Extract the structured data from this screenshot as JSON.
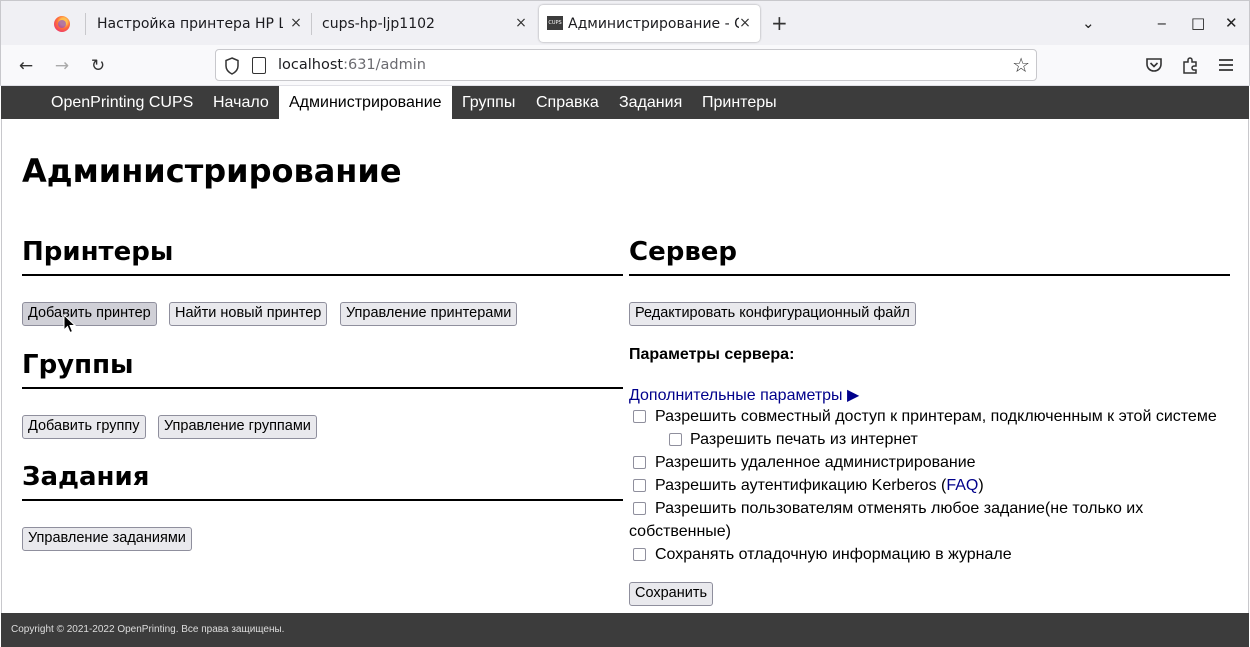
{
  "browser": {
    "tabs": [
      {
        "title": "Настройка принтера HP La",
        "close": "×"
      },
      {
        "title": "cups-hp-ljp1102",
        "close": "×"
      },
      {
        "title": "Администрирование - C",
        "close": "×"
      }
    ],
    "favicon_cups": "CUPS",
    "new_tab": "+",
    "url_host": "localhost",
    "url_rest": ":631/admin",
    "window_controls": {
      "list": "⌄",
      "minimize": "‒",
      "maximize": "□",
      "close": "✕"
    }
  },
  "cups_nav": {
    "items": [
      "OpenPrinting CUPS",
      "Начало",
      "Администрирование",
      "Группы",
      "Справка",
      "Задания",
      "Принтеры"
    ]
  },
  "page": {
    "title": "Администрирование",
    "printers": {
      "heading": "Принтеры",
      "buttons": [
        "Добавить принтер",
        "Найти новый принтер",
        "Управление принтерами"
      ]
    },
    "groups": {
      "heading": "Группы",
      "buttons": [
        "Добавить группу",
        "Управление группами"
      ]
    },
    "jobs": {
      "heading": "Задания",
      "buttons": [
        "Управление заданиями"
      ]
    },
    "server": {
      "heading": "Сервер",
      "edit_button": "Редактировать конфигурационный файл",
      "settings_label": "Параметры сервера:",
      "advanced_link": "Дополнительные параметры ▶",
      "options": {
        "share": "Разрешить совместный доступ к принтерам, подключенным к этой системе",
        "internet": "Разрешить печать из интернет",
        "remote_admin": "Разрешить удаленное администрирование",
        "kerberos_pre": "Разрешить аутентификацию Kerberos (",
        "kerberos_link": "FAQ",
        "kerberos_post": ")",
        "cancel_any_1": "Разрешить пользователям отменять любое задание(не только их",
        "cancel_any_2": "собственные)",
        "debug": "Сохранять отладочную информацию в журнале"
      },
      "save_button": "Сохранить"
    }
  },
  "footer": {
    "text": "Copyright © 2021-2022 OpenPrinting. Все права защищены."
  },
  "colors": {
    "cups_bar": "#3c3c3c",
    "link": "#00008b"
  }
}
